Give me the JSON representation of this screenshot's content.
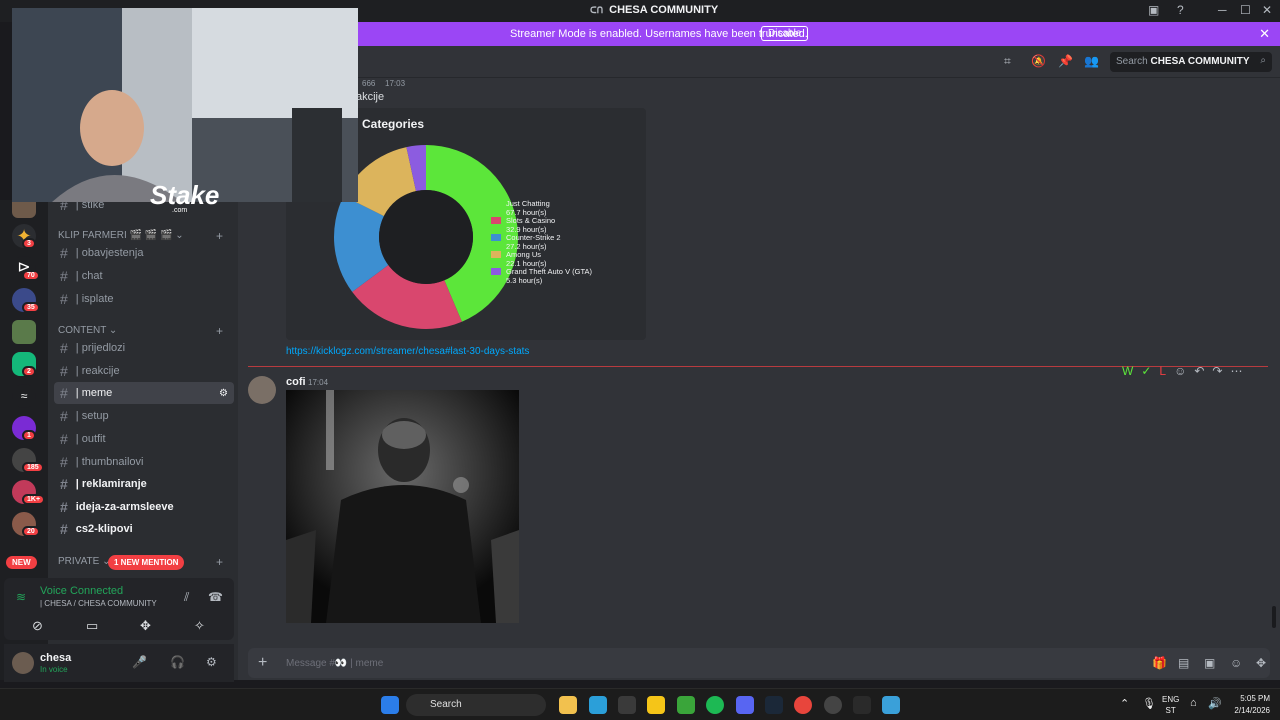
{
  "window": {
    "title": "CHESA COMMUNITY"
  },
  "streamer_bar": {
    "message": "Streamer Mode is enabled. Usernames have been truncated.",
    "disable_label": "Disable"
  },
  "webcam": {
    "logo": "Stake",
    "logo_sub": ".com"
  },
  "guild_badges": [
    {
      "label": "3"
    },
    {
      "label": "70"
    },
    {
      "label": "35"
    },
    {
      "label": "2"
    },
    {
      "label": "1"
    },
    {
      "label": "185"
    },
    {
      "label": "1K+"
    },
    {
      "label": "20"
    }
  ],
  "guild_new_label": "NEW",
  "sidebar": {
    "top_item": "| stike",
    "categories": [
      {
        "name": "KLIP FARMERI 🎬 🎬 🎬"
      },
      {
        "name": "CONTENT"
      },
      {
        "name": "PRIVATE"
      }
    ],
    "klip_channels": [
      {
        "label": "| obavjestenja"
      },
      {
        "label": "| chat"
      },
      {
        "label": "| isplate"
      }
    ],
    "content_channels": [
      {
        "label": "| prijedlozi"
      },
      {
        "label": "| reakcije"
      },
      {
        "label": "| meme"
      },
      {
        "label": "| setup"
      },
      {
        "label": "| outfit"
      },
      {
        "label": "| thumbnailovi"
      },
      {
        "label": "| reklamiranje"
      },
      {
        "label": "ideja-za-armsleeve"
      },
      {
        "label": "cs2-klipovi"
      }
    ],
    "mention_pill": "1 NEW MENTION"
  },
  "voice": {
    "status": "Voice Connected",
    "server": "| CHESA / CHESA COMMUNITY"
  },
  "user": {
    "name": "chesa",
    "status": "In voice"
  },
  "toolbar": {
    "search_prefix": "Search",
    "search_server": "CHESA COMMUNITY"
  },
  "messages": {
    "first": {
      "author_suffix": "666",
      "time": "17:03",
      "text": "akcije"
    },
    "embed_title": "Categories",
    "link": "https://kicklogz.com/streamer/chesa#last-30-days-stats",
    "second": {
      "author": "cofi",
      "time": "17:04"
    }
  },
  "chart_data": {
    "type": "pie",
    "title": "Categories",
    "categories": [
      "Just Chatting",
      "Slots & Casino",
      "Counter-Strike 2",
      "Among Us",
      "Grand Theft Auto V (GTA)"
    ],
    "values": [
      67.7,
      32.9,
      27.2,
      22.1,
      5.3
    ],
    "value_labels": [
      "67.7 hour(s)",
      "32.9 hour(s)",
      "27.2 hour(s)",
      "22.1 hour(s)",
      "5.3 hour(s)"
    ],
    "colors": [
      "#5ce63a",
      "#d9476e",
      "#3d8fd1",
      "#dcb45c",
      "#8c5ce0"
    ],
    "legend_position": "right"
  },
  "composer": {
    "placeholder": "Message #👀 | meme"
  },
  "taskbar": {
    "search_label": "Search",
    "lang_top": "ENG",
    "lang_bottom": "ST",
    "time": "5:05 PM",
    "date": "2/14/2026"
  }
}
